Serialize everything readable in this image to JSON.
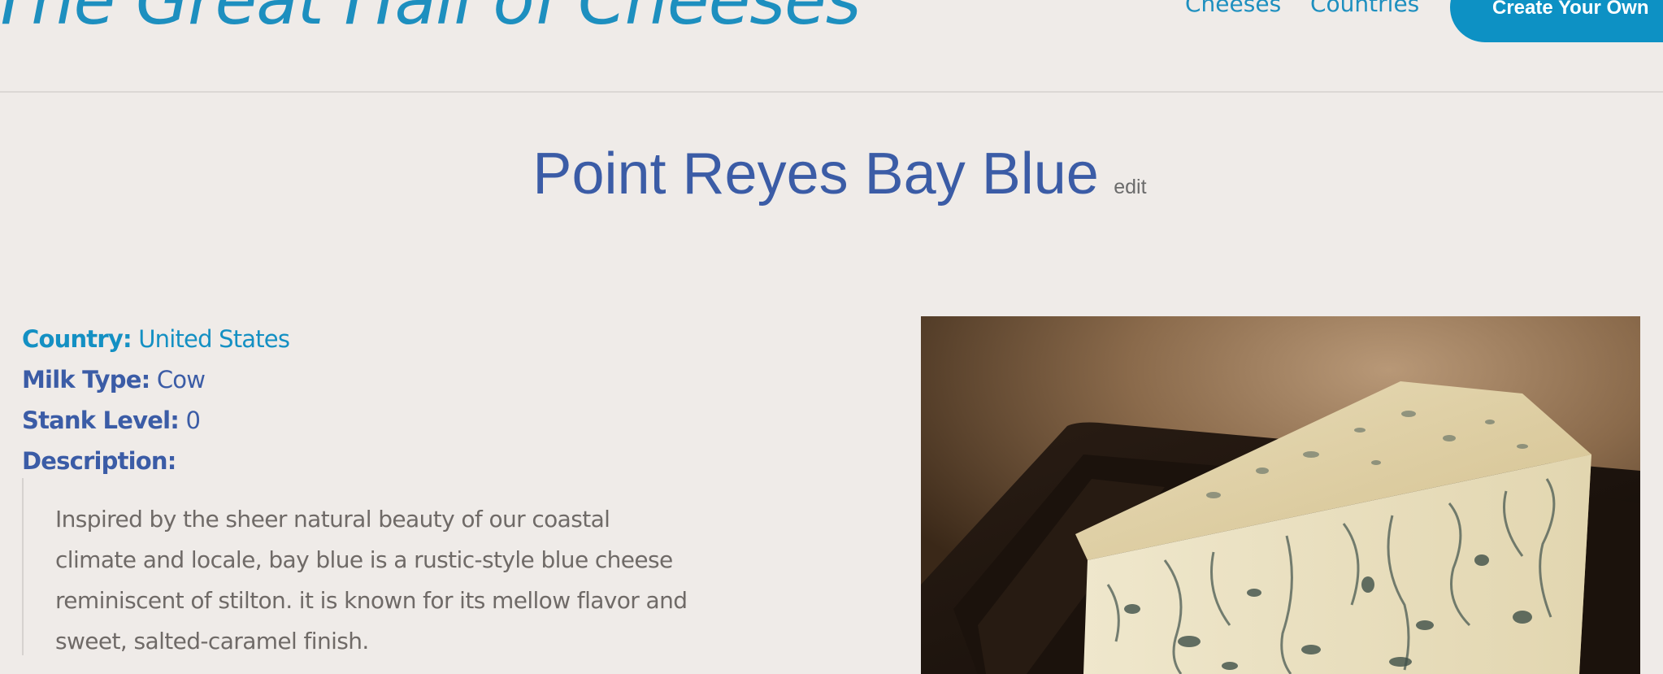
{
  "header": {
    "site_title": "The Great Hall of Cheeses",
    "nav": {
      "cheeses": "Cheeses",
      "countries": "Countries"
    },
    "create_button": "Create Your Own"
  },
  "cheese": {
    "name": "Point Reyes Bay Blue",
    "edit_label": "edit",
    "details": {
      "country_label": "Country:",
      "country_value": "United States",
      "milk_label": "Milk Type:",
      "milk_value": "Cow",
      "stank_label": "Stank Level:",
      "stank_value": "0",
      "description_label": "Description:"
    },
    "description_lines": [
      "Inspired by the sheer natural beauty of our coastal",
      "climate and locale, bay blue is a rustic-style blue cheese",
      "reminiscent of stilton. it is known for its mellow flavor and",
      "sweet, salted-caramel finish."
    ]
  },
  "colors": {
    "background": "#efebe8",
    "accent": "#1d8fbf",
    "title_blue": "#3b5ca6",
    "button": "#0d91c4"
  }
}
